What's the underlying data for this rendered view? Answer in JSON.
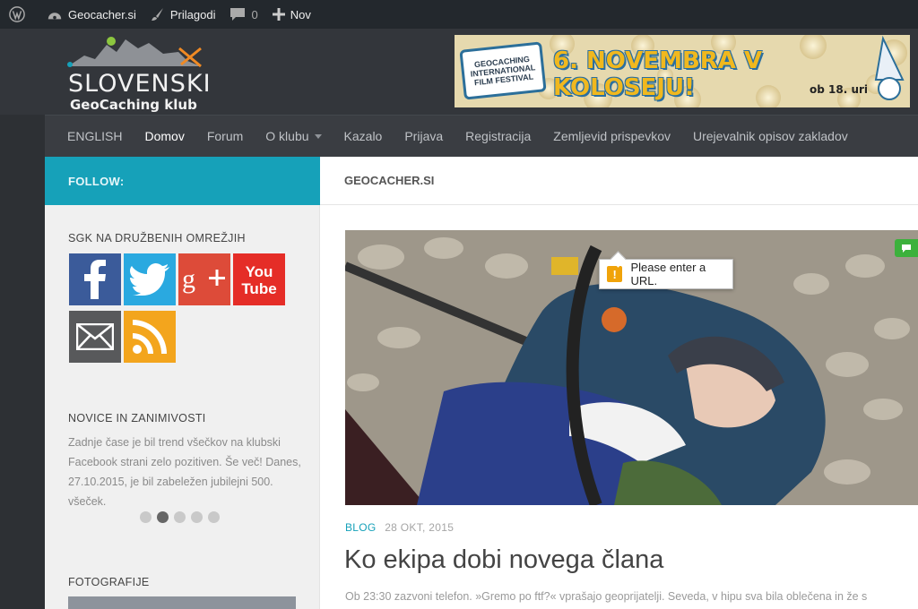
{
  "adminbar": {
    "site": "Geocacher.si",
    "customize": "Prilagodi",
    "comments": "0",
    "new": "Nov"
  },
  "header": {
    "logo_title": "SLOVENSKI",
    "logo_sub": "GeoCaching klub",
    "banner": {
      "ticket_text": "GEOCACHING INTERNATIONAL FILM FESTIVAL",
      "headline": "6. NOVEMBRA V KOLOSEJU!",
      "time": "ob 18. uri"
    }
  },
  "nav": {
    "items": [
      "ENGLISH",
      "Domov",
      "Forum",
      "O klubu",
      "Kazalo",
      "Prijava",
      "Registracija",
      "Zemljevid prispevkov",
      "Urejevalnik opisov zakladov"
    ]
  },
  "follow_label": "FOLLOW:",
  "breadcrumb": "GEOCACHER.SI",
  "sidebar": {
    "social_title": "SGK NA DRUŽBENIH OMREŽJIH",
    "social": [
      {
        "name": "facebook-icon",
        "color": "#3b5b9a"
      },
      {
        "name": "twitter-icon",
        "color": "#2aa9e0"
      },
      {
        "name": "googleplus-icon",
        "color": "#dd4b39"
      },
      {
        "name": "youtube-icon",
        "color": "#e52d27"
      },
      {
        "name": "email-icon",
        "color": "#58595b"
      },
      {
        "name": "rss-icon",
        "color": "#f3a51d"
      }
    ],
    "news_title": "NOVICE IN ZANIMIVOSTI",
    "news_text": "Zadnje čase je bil trend všečkov na klubski Facebook strani zelo pozitiven. Še več! Danes, 27.10.2015, je bil zabeležen jubilejni 500. všeček.",
    "photos_title": "FOTOGRAFIJE",
    "youtube_label": "You Tube"
  },
  "validation_tooltip": "Please enter a URL.",
  "post": {
    "category": "BLOG",
    "date": "28 OKT, 2015",
    "title": "Ko ekipa dobi novega člana",
    "excerpt": "Ob 23:30 zazvoni telefon. »Gremo po ftf?« vprašajo geoprijatelji. Seveda, v hipu sva bila oblečena in že s"
  }
}
